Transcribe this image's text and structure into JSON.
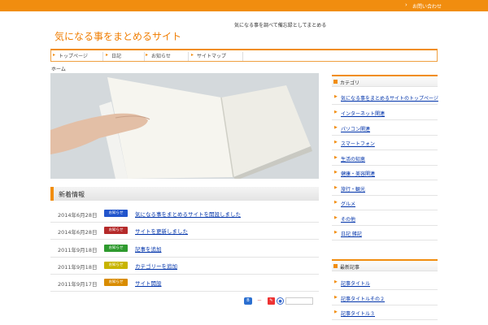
{
  "topbar": {
    "link_label": "お問い合わせ"
  },
  "header": {
    "tagline": "気になる事を調べて備忘録としてまとめる",
    "site_title": "気になる事をまとめるサイト"
  },
  "gnav": {
    "items": [
      "トップページ",
      "日記",
      "お知らせ",
      "サイトマップ"
    ]
  },
  "breadcrumb": "ホーム",
  "news": {
    "heading": "新着情報",
    "items": [
      {
        "date": "2014年6月28日",
        "badge": "お知らせ",
        "badge_color": "#2255cc",
        "title": "気になる事をまとめるサイトを開設しました"
      },
      {
        "date": "2014年6月28日",
        "badge": "お知らせ",
        "badge_color": "#b52a2a",
        "title": "サイトを更新しました"
      },
      {
        "date": "2011年9月18日",
        "badge": "お知らせ",
        "badge_color": "#2e9a2e",
        "title": "記事を追加"
      },
      {
        "date": "2011年9月18日",
        "badge": "お知らせ",
        "badge_color": "#c8b400",
        "title": "カテゴリーを追加"
      },
      {
        "date": "2011年9月17日",
        "badge": "お知らせ",
        "badge_color": "#d98c00",
        "title": "サイト開設"
      }
    ]
  },
  "sidebar": {
    "box1": {
      "title": "カテゴリ",
      "items": [
        "気になる事をまとめるサイトのトップページ",
        "インターネット関連",
        "パソコン関連",
        "スマートフォン",
        "生活の知恵",
        "健康・美容関連",
        "旅行・観光",
        "グルメ",
        "その他",
        "日記 雑記"
      ]
    },
    "box2": {
      "title": "最新記事",
      "items": [
        "記事タイトル",
        "記事タイトルその２",
        "記事タイトル３"
      ]
    }
  },
  "colors": {
    "accent": "#f18d0f",
    "link": "#0033aa"
  }
}
